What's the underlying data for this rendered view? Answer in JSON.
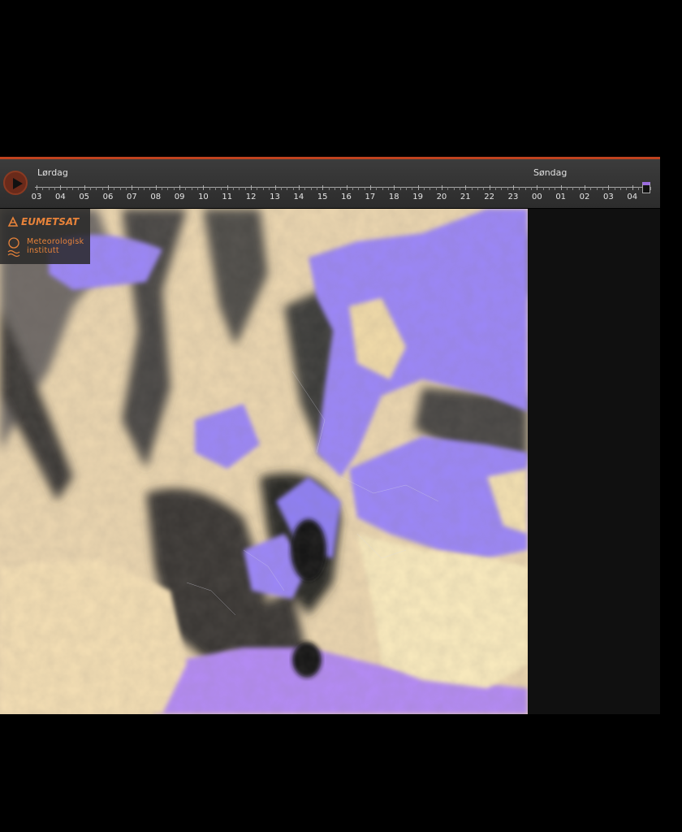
{
  "timeline": {
    "day_start": "Lørdag",
    "day_end": "Søndag",
    "hours": [
      "03",
      "04",
      "05",
      "06",
      "07",
      "08",
      "09",
      "10",
      "11",
      "12",
      "13",
      "14",
      "15",
      "16",
      "17",
      "18",
      "19",
      "20",
      "21",
      "22",
      "23",
      "00",
      "01",
      "02",
      "03",
      "04"
    ]
  },
  "logos": {
    "eumetsat": "EUMETSAT",
    "met_line1": "Meteorologisk",
    "met_line2": "institutt"
  },
  "colors": {
    "accent": "#c0431f",
    "logo_orange": "#e8833a",
    "clear_land": "#9b86f5",
    "low_cloud": "#f4d9a8",
    "high_cloud": "#3c3c3c"
  }
}
